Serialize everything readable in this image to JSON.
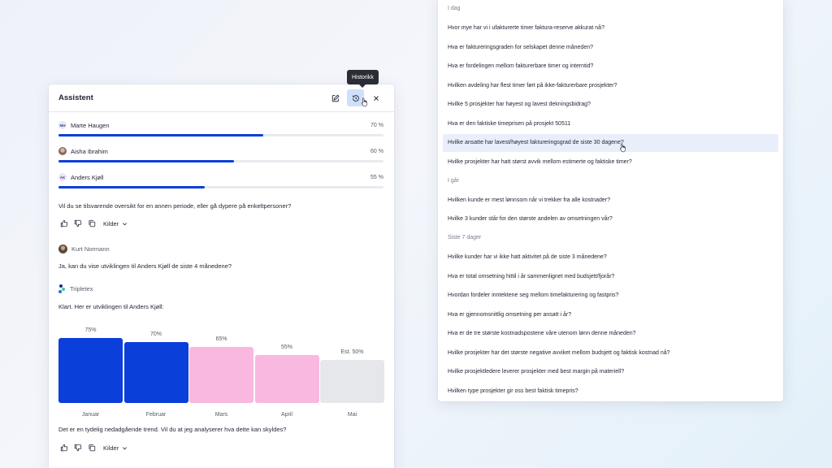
{
  "assistant": {
    "title": "Assistent",
    "tooltip": "Historikk",
    "people": [
      {
        "initials": "MH",
        "name": "Marte Haugen",
        "pct_label": "70 %",
        "progress": 0.63,
        "avatar_bg": "#e6e9f5",
        "avatar_fg": "#3c4a88"
      },
      {
        "initials": "",
        "name": "Aisha Ibrahim",
        "pct_label": "60 %",
        "progress": 0.54,
        "avatar_bg": "#d9c3b6",
        "avatar_fg": "#5a3e30"
      },
      {
        "initials": "AK",
        "name": "Anders Kjøll",
        "pct_label": "55 %",
        "progress": 0.45,
        "avatar_bg": "#ece4f7",
        "avatar_fg": "#5b3f8a"
      }
    ],
    "question1": "Vil du se tilsvarende oversikt for en annen periode, eller gå dypere på enkeltpersoner?",
    "sources_label": "Kilder",
    "user_name": "Kurt Normann",
    "user_message": "Ja, kan du vise utviklingen til Anders Kjøll de siste 4 månedene?",
    "bot_name": "Tripletex",
    "bot_message": "Klart. Her er utviklingen til Anders Kjøll:",
    "question2": "Det er en tydelig nedadgående trend. Vil du at jeg analyserer hva dette kan skyldes?"
  },
  "chart_data": {
    "type": "bar",
    "categories": [
      "Januar",
      "Februar",
      "Mars",
      "April",
      "Mai"
    ],
    "values": [
      75,
      70,
      65,
      55,
      50
    ],
    "value_labels": [
      "75%",
      "70%",
      "65%",
      "55%",
      "Est. 50%"
    ],
    "colors": [
      "#0b3fd9",
      "#0b3fd9",
      "#f9b8df",
      "#f9b8df",
      "#e6e7eb"
    ],
    "title": "",
    "xlabel": "",
    "ylabel": "",
    "ylim": [
      0,
      75
    ],
    "grid": false
  },
  "history": {
    "groups": [
      {
        "label": "I dag",
        "items": [
          "Hvor mye har vi i ufakturerte timer faktura-reserve akkurat nå?",
          "Hva er faktureringsgraden for selskapet denne måneden?",
          "Hva er fordelingen mellom fakturerbare timer og interntid?",
          "Hvilken avdeling har flest timer ført på ikke-fakturerbare prosjekter?",
          "Hvilke 5 prosjekter har høyest og lavest dekningsbidrag?",
          "Hva er den faktiske timeprisen på prosjekt 50511",
          "Hvilke ansatte har lavest/høyest faktureringsgrad de siste 30 dagene?",
          "Hvilke prosjekter har hatt størst avvik mellom estimerte og faktiske timer?"
        ]
      },
      {
        "label": "I går",
        "items": [
          "Hvilken kunde er mest lønnsom når vi trekker fra alle kostnader?",
          "Hvilke 3 kunder står for den største andelen av omsetningen vår?"
        ]
      },
      {
        "label": "Siste 7 dager",
        "items": [
          "Hvilke kunder har vi ikke hatt aktivitet på de siste 3 månedene?",
          "Hva er total omsetning hittil i år sammenlignet med budsjett/fjorår?",
          "Hvordan fordeler inntektene seg mellom timefakturering og fastpris?",
          "Hva er gjennomsnittlig omsetning per ansatt i år?",
          "Hva er de tre største kostnadspostene våre utenom lønn denne måneden?",
          "Hvilke prosjekter har det største negative avviket mellom budsjett og faktisk kostnad nå?",
          "Hvilke prosjektledere leverer prosjekter med best margin på materiell?",
          "Hvilken type prosjekter gir oss best faktisk timepris?"
        ]
      }
    ]
  }
}
